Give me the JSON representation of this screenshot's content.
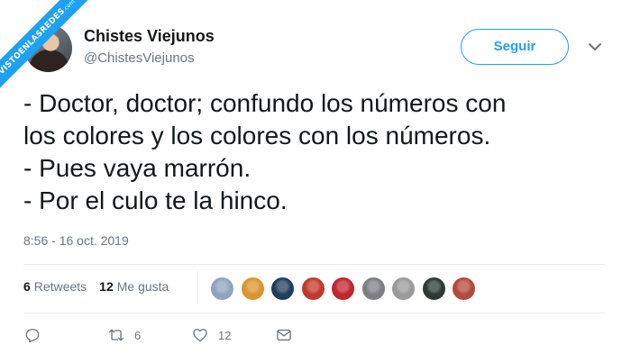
{
  "watermark": {
    "text": "VISTOENLASREDES",
    "domain": ".com"
  },
  "author": {
    "name": "Chistes Viejunos",
    "handle": "@ChistesViejunos"
  },
  "follow_label": "Seguir",
  "tweet": {
    "lines": [
      "- Doctor, doctor; confundo los números con",
      "los colores y los colores con los números.",
      "- Pues vaya marrón.",
      "- Por el culo te la hinco."
    ],
    "timestamp": "8:56 - 16 oct. 2019"
  },
  "stats": {
    "retweets_count": "6",
    "retweets_label": "Retweets",
    "likes_count": "12",
    "likes_label": "Me gusta"
  },
  "likers": [
    {
      "icon": "person-photo-avatar",
      "color": "#8da4c0"
    },
    {
      "icon": "orange-circle-avatar",
      "color": "#d9962e"
    },
    {
      "icon": "dark-blue-avatar",
      "color": "#1e3f5a"
    },
    {
      "icon": "red-figure-avatar",
      "color": "#c0392b"
    },
    {
      "icon": "rebel-alliance-avatar",
      "color": "#c0262d"
    },
    {
      "icon": "grey-photo-avatar",
      "color": "#7d7d86"
    },
    {
      "icon": "bw-photo-avatar",
      "color": "#9a9a9a"
    },
    {
      "icon": "dark-green-avatar",
      "color": "#2c3a33"
    },
    {
      "icon": "white-red-avatar",
      "color": "#b34a3c"
    }
  ],
  "actions": {
    "retweet_count": "6",
    "like_count": "12"
  }
}
